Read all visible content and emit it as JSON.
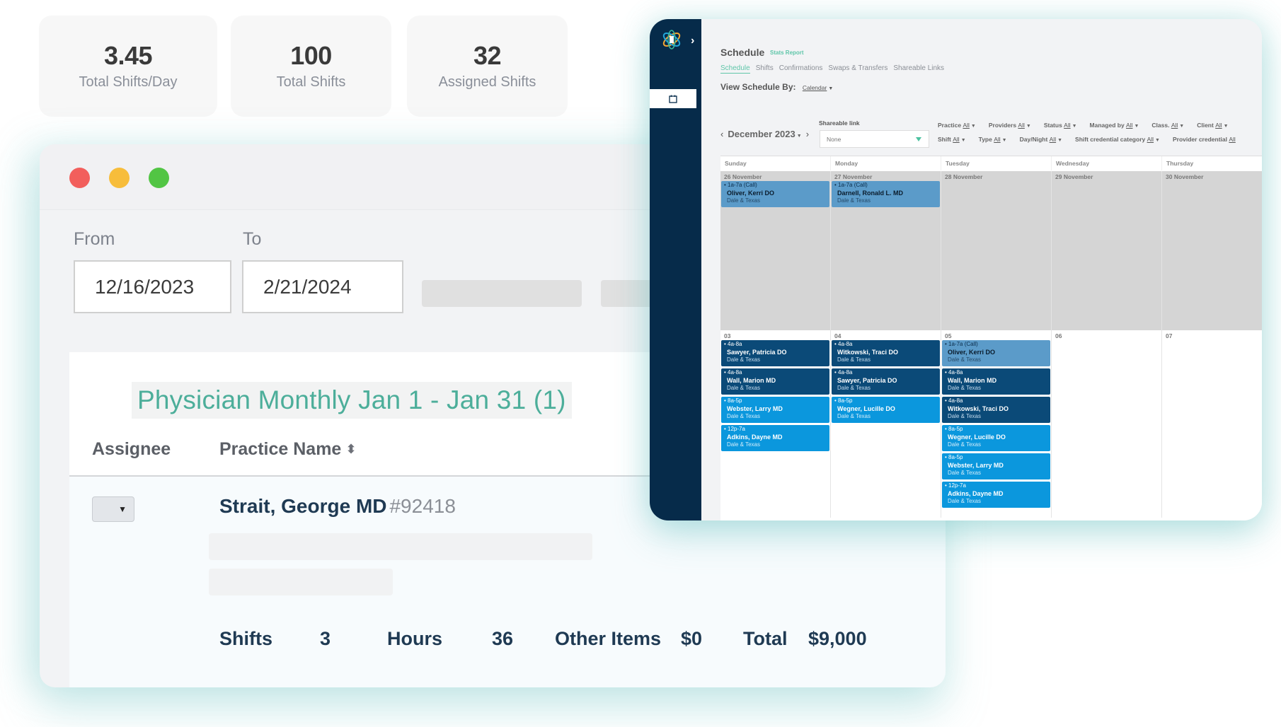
{
  "stats": [
    {
      "value": "3.45",
      "label": "Total Shifts/Day"
    },
    {
      "value": "100",
      "label": "Total Shifts"
    },
    {
      "value": "32",
      "label": "Assigned Shifts"
    }
  ],
  "report_window": {
    "window_controls": {
      "close_color": "#f25f5c",
      "minimize_color": "#f7bd3b",
      "maximize_color": "#52c544"
    },
    "from_label": "From",
    "to_label": "To",
    "from_value": "12/16/2023",
    "to_value": "2/21/2024",
    "report_title": "Physician Monthly Jan 1 - Jan 31 (1)",
    "columns": {
      "assignee": "Assignee",
      "practice_name": "Practice Name"
    },
    "row": {
      "provider_name": "Strait, George MD",
      "provider_id": "#92418"
    },
    "summary": {
      "shifts_label": "Shifts",
      "shifts_value": "3",
      "hours_label": "Hours",
      "hours_value": "36",
      "other_label": "Other Items",
      "other_value": "$0",
      "total_label": "Total",
      "total_value": "$9,000"
    }
  },
  "schedule_window": {
    "title": "Schedule",
    "stats_link": "Stats Report",
    "tabs": [
      "Schedule",
      "Shifts",
      "Confirmations",
      "Swaps & Transfers",
      "Shareable Links"
    ],
    "active_tab": "Schedule",
    "view_by_label": "View Schedule By:",
    "view_by_value": "Calendar",
    "month": "December 2023",
    "shareable_link_label": "Shareable link",
    "shareable_link_value": "None",
    "filters_row1": [
      {
        "label": "Practice",
        "value": "All"
      },
      {
        "label": "Providers",
        "value": "All"
      },
      {
        "label": "Status",
        "value": "All"
      },
      {
        "label": "Managed by",
        "value": "All"
      },
      {
        "label": "Class.",
        "value": "All"
      },
      {
        "label": "Client",
        "value": "All"
      }
    ],
    "filters_row2": [
      {
        "label": "Shift",
        "value": "All"
      },
      {
        "label": "Type",
        "value": "All"
      },
      {
        "label": "Day/Night",
        "value": "All"
      },
      {
        "label": "Shift credential category",
        "value": "All"
      },
      {
        "label": "Provider credential",
        "value": "All"
      }
    ],
    "weekdays": [
      "Sunday",
      "Monday",
      "Tuesday",
      "Wednesday",
      "Thursday"
    ],
    "week1": [
      {
        "date": "26 November",
        "shifts": [
          {
            "time": "1a-7a (Call)",
            "name": "Oliver, Kerri DO",
            "location": "Dale & Texas",
            "kind": "call"
          }
        ]
      },
      {
        "date": "27 November",
        "shifts": [
          {
            "time": "1a-7a (Call)",
            "name": "Darnell, Ronald L. MD",
            "location": "Dale & Texas",
            "kind": "call"
          }
        ]
      },
      {
        "date": "28 November",
        "shifts": []
      },
      {
        "date": "29 November",
        "shifts": []
      },
      {
        "date": "30 November",
        "shifts": []
      }
    ],
    "week2": [
      {
        "date": "03",
        "shifts": [
          {
            "time": "4a-8a",
            "name": "Sawyer, Patricia DO",
            "location": "Dale & Texas",
            "kind": "dark"
          },
          {
            "time": "4a-8a",
            "name": "Wall, Marion MD",
            "location": "Dale & Texas",
            "kind": "dark"
          },
          {
            "time": "8a-5p",
            "name": "Webster, Larry MD",
            "location": "Dale & Texas",
            "kind": "bright"
          },
          {
            "time": "12p-7a",
            "name": "Adkins, Dayne MD",
            "location": "Dale & Texas",
            "kind": "bright"
          }
        ]
      },
      {
        "date": "04",
        "shifts": [
          {
            "time": "4a-8a",
            "name": "Witkowski, Traci DO",
            "location": "Dale & Texas",
            "kind": "dark"
          },
          {
            "time": "4a-8a",
            "name": "Sawyer, Patricia DO",
            "location": "Dale & Texas",
            "kind": "dark"
          },
          {
            "time": "8a-5p",
            "name": "Wegner, Lucille DO",
            "location": "Dale & Texas",
            "kind": "bright"
          }
        ]
      },
      {
        "date": "05",
        "shifts": [
          {
            "time": "1a-7a (Call)",
            "name": "Oliver, Kerri DO",
            "location": "Dale & Texas",
            "kind": "call"
          },
          {
            "time": "4a-8a",
            "name": "Wall, Marion MD",
            "location": "Dale & Texas",
            "kind": "dark"
          },
          {
            "time": "4a-8a",
            "name": "Witkowski, Traci DO",
            "location": "Dale & Texas",
            "kind": "dark"
          },
          {
            "time": "8a-5p",
            "name": "Wegner, Lucille DO",
            "location": "Dale & Texas",
            "kind": "bright"
          },
          {
            "time": "8a-5p",
            "name": "Webster, Larry MD",
            "location": "Dale & Texas",
            "kind": "bright"
          },
          {
            "time": "12p-7a",
            "name": "Adkins, Dayne MD",
            "location": "Dale & Texas",
            "kind": "bright"
          }
        ]
      },
      {
        "date": "06",
        "shifts": []
      },
      {
        "date": "07",
        "shifts": []
      }
    ],
    "shift_colors": {
      "call": "#5b9bc9",
      "dark": "#0b4a78",
      "bright": "#0b97dd"
    },
    "sidebar_color": "#062b4a",
    "accent_color": "#5fc6a9"
  }
}
